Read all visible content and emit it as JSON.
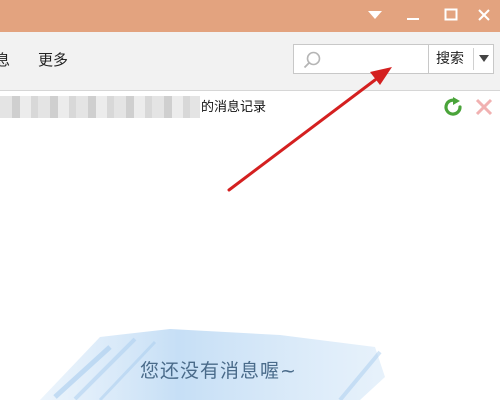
{
  "toolbar": {
    "menu_partial": "息",
    "menu_more": "更多"
  },
  "search": {
    "value": "",
    "placeholder": "",
    "button_label": "搜索"
  },
  "history": {
    "contact_name_redacted": "",
    "title_suffix": "的消息记录"
  },
  "main": {
    "empty_message": "您还没有消息喔~"
  },
  "colors": {
    "titlebar": "#e3a37f",
    "toolbar_bg": "#f2f2f2",
    "refresh_green": "#4aa43a",
    "close_red_disabled": "#f1b1b1",
    "annotation_arrow": "#d42020",
    "empty_text": "#4a6b8a"
  },
  "icons": {
    "dropdown": "triangle-down-icon",
    "minimize": "minimize-icon",
    "maximize": "maximize-icon",
    "close_window": "close-icon",
    "search": "search-icon",
    "refresh": "refresh-icon",
    "delete": "delete-icon"
  }
}
